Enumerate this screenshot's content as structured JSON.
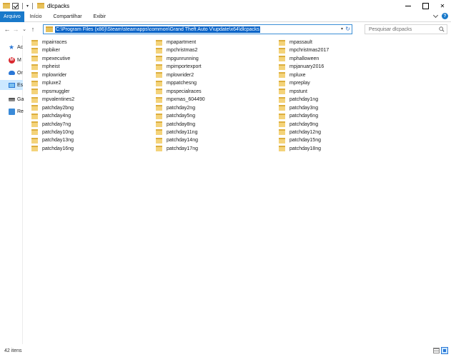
{
  "window": {
    "title": "dlcpacks",
    "close_glyph": "✕"
  },
  "ribbon": {
    "tabs": [
      {
        "label": "Arquivo",
        "active": true
      },
      {
        "label": "Início",
        "active": false
      },
      {
        "label": "Compartilhar",
        "active": false
      },
      {
        "label": "Exibir",
        "active": false
      }
    ],
    "help_glyph": "?"
  },
  "nav": {
    "back_glyph": "←",
    "forward_glyph": "→",
    "recent_glyph": "⌄",
    "up_glyph": "↑",
    "address": "C:\\Program Files (x86)\\Steam\\steamapps\\common\\Grand Theft Auto V\\update\\x64\\dlcpacks",
    "refresh_glyph": "↻",
    "search_placeholder": "Pesquisar dlcpacks"
  },
  "sidebar": {
    "items": [
      {
        "label": "Ac",
        "icon": "star-icon",
        "selected": false
      },
      {
        "label": "M",
        "icon": "mega-icon",
        "selected": false
      },
      {
        "label": "Or",
        "icon": "cloud-icon",
        "selected": false
      },
      {
        "label": "Es",
        "icon": "computer-icon",
        "selected": true
      },
      {
        "label": "Ga",
        "icon": "drive-icon",
        "selected": false
      },
      {
        "label": "Re",
        "icon": "network-icon",
        "selected": false
      }
    ],
    "mega_letter": "M"
  },
  "files": {
    "col1": [
      "mpairraces",
      "mpbiker",
      "mpexecutive",
      "mpheist",
      "mplowrider",
      "mpluxe2",
      "mpsmuggler",
      "mpvalentines2",
      "patchday2bng",
      "patchday4ng",
      "patchday7ng",
      "patchday10ng",
      "patchday13ng",
      "patchday16ng"
    ],
    "col2": [
      "mpapartment",
      "mpchristmas2",
      "mpgunrunning",
      "mpimportexport",
      "mplowrider2",
      "mppatchesng",
      "mpspecialraces",
      "mpxmas_604490",
      "patchday2ng",
      "patchday5ng",
      "patchday8ng",
      "patchday11ng",
      "patchday14ng",
      "patchday17ng"
    ],
    "col3": [
      "mpassault",
      "mpchristmas2017",
      "mphalloween",
      "mpjanuary2016",
      "mpluxe",
      "mpreplay",
      "mpstunt",
      "patchday1ng",
      "patchday3ng",
      "patchday6ng",
      "patchday9ng",
      "patchday12ng",
      "patchday15ng",
      "patchday18ng"
    ]
  },
  "status": {
    "item_count": "42 itens"
  },
  "colors": {
    "accent": "#1979ca",
    "selection": "#cce8ff",
    "folder": "#f4d37a"
  }
}
